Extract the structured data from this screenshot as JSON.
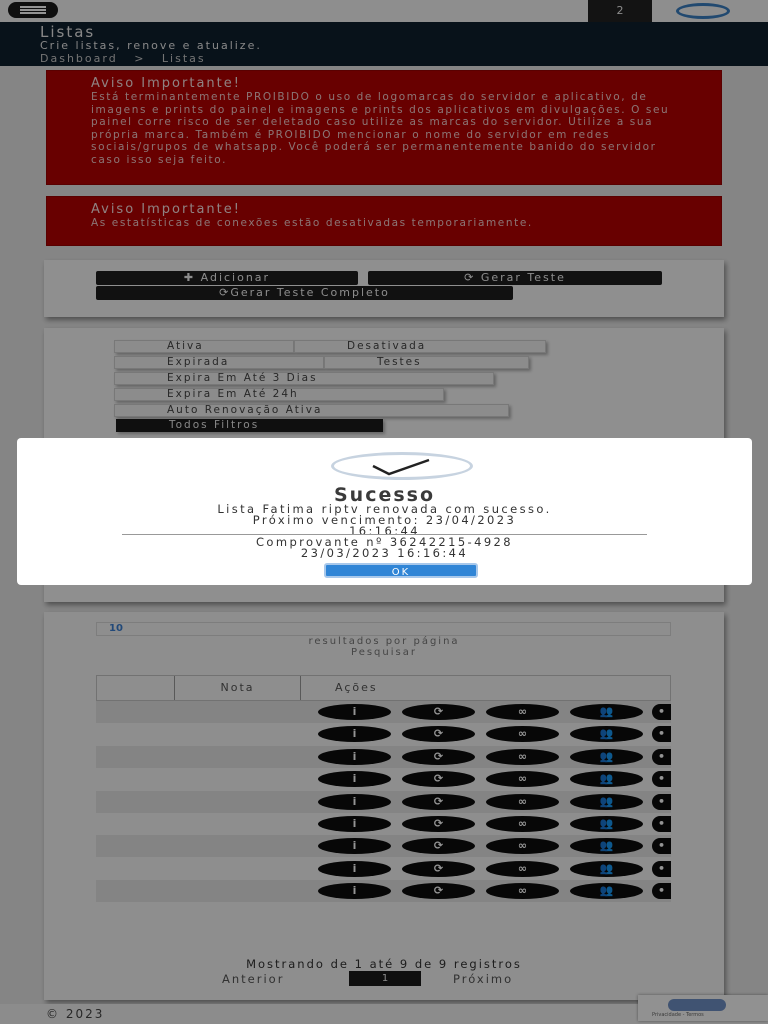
{
  "topbar": {
    "notification_count": "2",
    "menu_icon": "hamburger-icon",
    "avatar_icon": "user-avatar-icon"
  },
  "page": {
    "title": "Listas",
    "subtitle": "Crie listas, renove e atualize.",
    "breadcrumb_home": "Dashboard",
    "breadcrumb_sep": ">",
    "breadcrumb_current": "Listas"
  },
  "alerts": [
    {
      "title": "Aviso Importante!",
      "text": "Está terminantemente PROIBIDO o uso de logomarcas do servidor e aplicativo, de imagens e prints do painel e imagens e prints dos aplicativos em divulgações. O seu painel corre risco de ser deletado caso utilize as marcas do servidor. Utilize a sua própria marca. Também é PROIBIDO mencionar o nome do servidor em redes sociais/grupos de whatsapp. Você poderá ser permanentemente banido do servidor caso isso seja feito."
    },
    {
      "title": "Aviso Importante!",
      "text": "As estatísticas de conexões estão desativadas temporariamente."
    }
  ],
  "actions": {
    "add": "Adicionar",
    "test": "Gerar Teste",
    "full_test": "Gerar Teste Completo"
  },
  "filters": {
    "ativa": "Ativa",
    "desativada": "Desativada",
    "expirada": "Expirada",
    "testes": "Testes",
    "expira3": "Expira Em Até 3 Dias",
    "expira24": "Expira Em Até 24h",
    "auto": "Auto Renovação Ativa",
    "todos": "Todos Filtros"
  },
  "table": {
    "page_size": "10",
    "page_size_label": "resultados por página",
    "search_label": "Pesquisar",
    "columns": [
      "",
      "Nota",
      "Ações"
    ],
    "row_count": 9,
    "info": "Mostrando de 1 até 9 de 9 registros",
    "prev": "Anterior",
    "page": "1",
    "next": "Próximo"
  },
  "modal": {
    "title": "Sucesso",
    "line1": "Lista Fatima riptv renovada com sucesso.",
    "line2": "Próximo vencimento: 23/04/2023",
    "line3": "16:16:44",
    "receipt1": "Comprovante nº 36242215-4928",
    "receipt2": "23/03/2023 16:16:44",
    "ok": "OK"
  },
  "footer": {
    "copyright": "© 2023"
  },
  "recaptcha": {
    "text": "Privacidade - Termos"
  },
  "colors": {
    "alert": "#b30000",
    "ok_button": "#3085d6",
    "header": "#0e1f2e"
  }
}
